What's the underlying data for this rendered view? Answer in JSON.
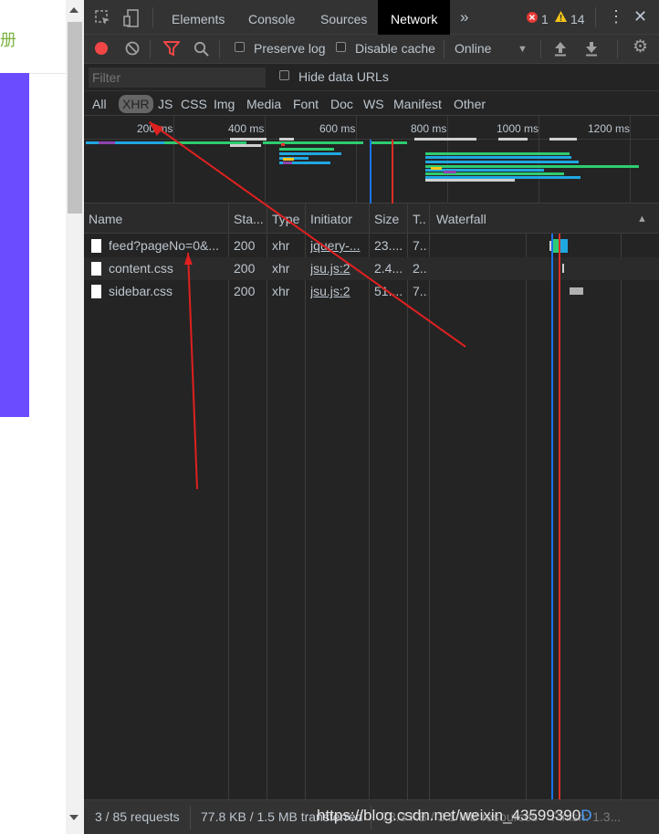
{
  "webpage": {
    "title_fragment": "册"
  },
  "devtools": {
    "tabs": [
      "Elements",
      "Console",
      "Sources",
      "Network"
    ],
    "active_tab": "Network",
    "more_tabs_icon": "double-chevron-right-icon",
    "errors": "1",
    "warnings": "14"
  },
  "network_toolbar": {
    "preserve_log": "Preserve log",
    "disable_cache": "Disable cache",
    "throttle": "Online"
  },
  "filter": {
    "placeholder": "Filter",
    "hide_data_urls": "Hide data URLs"
  },
  "types": [
    "All",
    "XHR",
    "JS",
    "CSS",
    "Img",
    "Media",
    "Font",
    "Doc",
    "WS",
    "Manifest",
    "Other"
  ],
  "active_type": "XHR",
  "overview": {
    "ticks": [
      "200 ms",
      "400 ms",
      "600 ms",
      "800 ms",
      "1000 ms",
      "1200 ms"
    ]
  },
  "table": {
    "columns": [
      "Name",
      "Sta...",
      "Type",
      "Initiator",
      "Size",
      "T..",
      "Waterfall"
    ],
    "rows": [
      {
        "name": "feed?pageNo=0&...",
        "status": "200",
        "type": "xhr",
        "initiator": "jquery-...",
        "size": "23....",
        "time": "7..."
      },
      {
        "name": "content.css",
        "status": "200",
        "type": "xhr",
        "initiator": "jsu.js:2",
        "size": "2.4...",
        "time": "2..."
      },
      {
        "name": "sidebar.css",
        "status": "200",
        "type": "xhr",
        "initiator": "jsu.js:2",
        "size": "51....",
        "time": "7..."
      }
    ]
  },
  "status_bar": {
    "requests": "3 / 85 requests",
    "transferred": "77.8 KB / 1.5 MB transferred",
    "resources": "78.3 KB / 3.1 MB resources",
    "finish": "Finish: 1.3..."
  },
  "watermark": {
    "text": "https://blog.csdn.net/weixin_43599390",
    "tail": "D"
  },
  "colors": {
    "annotation_arrow": "#e02020",
    "record_red": "#f24646",
    "accent_blue": "#1a73e8"
  }
}
